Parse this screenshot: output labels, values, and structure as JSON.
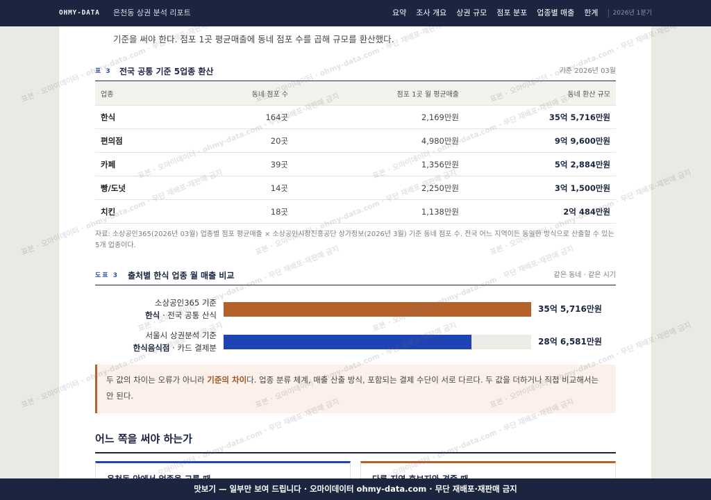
{
  "nav": {
    "logo": "OHMY-DATA",
    "title": "은천동 상권 분석 리포트",
    "links": [
      "요약",
      "조사 개요",
      "상권 규모",
      "점포 분포",
      "업종별 매출",
      "한계"
    ],
    "period": "2026년 1분기"
  },
  "intro": {
    "text": "기준을 써야 한다. 점포 1곳 평균매출에 동네 점포 수를 곱해 규모를 환산했다."
  },
  "table": {
    "label": "표 3",
    "title": "전국 공통 기준 5업종 환산",
    "meta": "기준 2026년 03월",
    "columns": [
      "업종",
      "동네 점포 수",
      "점포 1곳 월 평균매출",
      "동네 환산 규모"
    ],
    "rows": [
      [
        "한식",
        "164곳",
        "2,169만원",
        "35억 5,716만원"
      ],
      [
        "편의점",
        "20곳",
        "4,980만원",
        "9억 9,600만원"
      ],
      [
        "카페",
        "39곳",
        "1,356만원",
        "5억 2,884만원"
      ],
      [
        "빵/도넛",
        "14곳",
        "2,250만원",
        "3억 1,500만원"
      ],
      [
        "치킨",
        "18곳",
        "1,138만원",
        "2억 484만원"
      ]
    ],
    "note": "자료: 소상공인365(2026년 03월) 업종별 점포 평균매출 × 소상공인시장진흥공단 상가정보(2026년 3월) 기준 동네 점포 수. 전국 어느 지역이든 동일한 방식으로 산출할 수 있는 5개 업종이다."
  },
  "figure": {
    "label": "도표 3",
    "meta": "같은 동네 · 같은 시기"
  },
  "chart_data": {
    "type": "bar",
    "orientation": "horizontal",
    "title": "출처별 한식 업종 월 매출 비교",
    "categories": [
      "소상공인365 기준",
      "서울시 상권분석 기준"
    ],
    "category_details": [
      {
        "bold": "한식",
        "rest": " · 전국 공통 산식"
      },
      {
        "bold": "한식음식점",
        "rest": " · 카드 결제분"
      }
    ],
    "values": [
      355716,
      286581
    ],
    "value_labels": [
      "35억 5,716만원",
      "28억 6,581만원"
    ],
    "xlim": [
      0,
      355716
    ],
    "colors": [
      "#b5612b",
      "#1e44b4"
    ],
    "grid": false,
    "legend": "none"
  },
  "callout": {
    "before": "두 값의 차이는 오류가 아니라 ",
    "emph": "기준의 차이",
    "after": "다. 업종 분류 체계, 매출 산출 방식, 포함되는 결제 수단이 서로 다르다. 두 값을 더하거나 직접 비교해서는 안 된다."
  },
  "section": {
    "heading": "어느 쪽을 써야 하는가",
    "cards": [
      {
        "title": "은천동 안에서 업종을 고를 때"
      },
      {
        "title": "다른 지역 후보지와 견줄 때"
      }
    ]
  },
  "footer": {
    "text": "맛보기 — 일부만 보여 드립니다 · 오마이데이터 ohmy-data.com · 무단 재배포·재판매 금지"
  },
  "watermark": "표본 · 오마이데이터 · ohmy-data.com · 무단 재배포·재판매 금지",
  "colors": {
    "navy": "#1b2540",
    "accent_orange": "#b5612b",
    "accent_blue": "#1e44b4",
    "callout_bg": "#fbf1ea",
    "page_bg": "#ebe9e3"
  }
}
